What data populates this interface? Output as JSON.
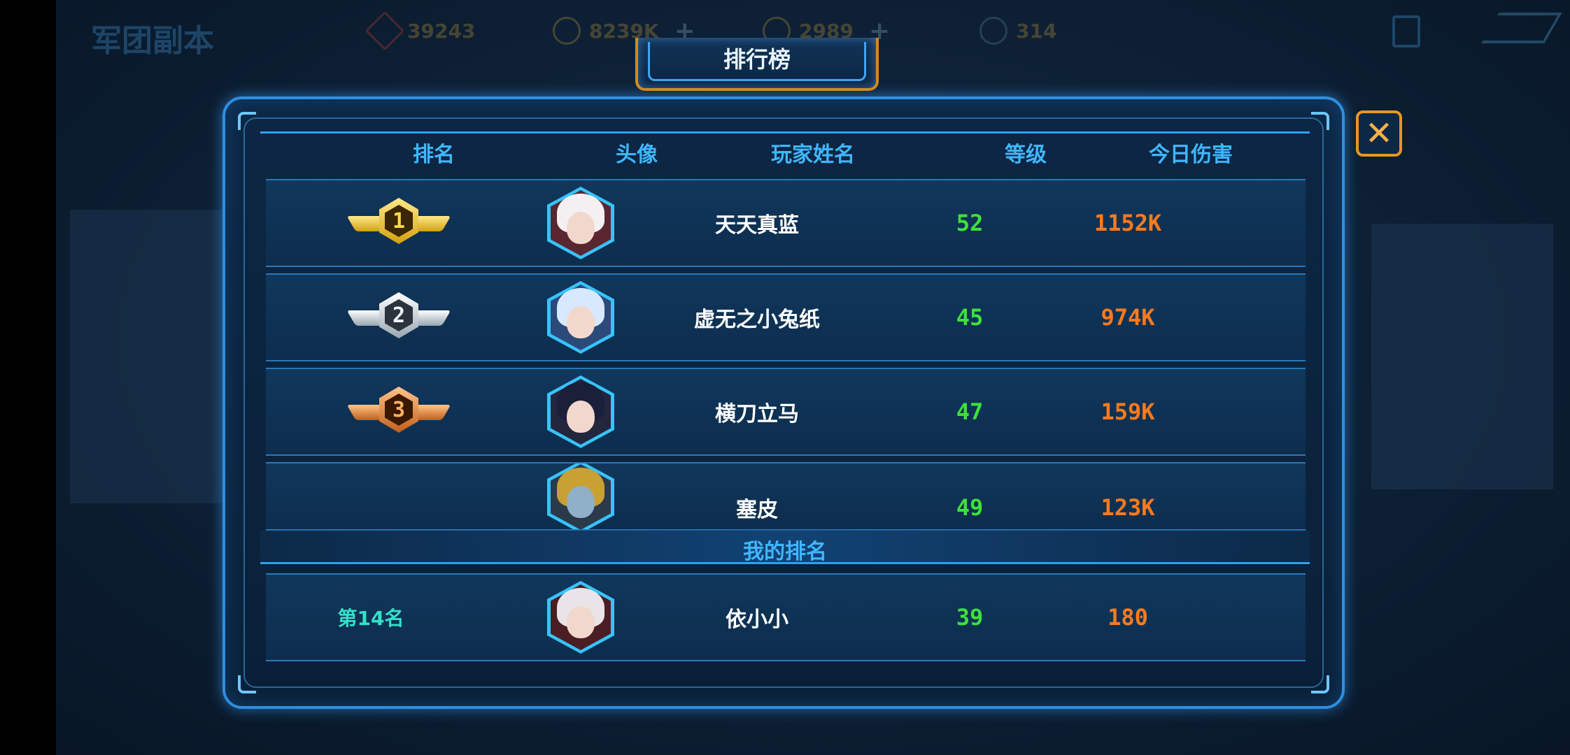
{
  "top_bar": {
    "title": "军团副本",
    "resources": [
      {
        "icon": "gem-icon",
        "value": "39243"
      },
      {
        "icon": "gold-coin-icon",
        "value": "8239K"
      },
      {
        "icon": "crown-icon",
        "value": "2989"
      },
      {
        "icon": "medal-icon",
        "value": "314"
      }
    ]
  },
  "leaderboard": {
    "title": "排行榜",
    "headers": {
      "rank": "排名",
      "avatar": "头像",
      "player_name": "玩家姓名",
      "level": "等级",
      "damage_today": "今日伤害"
    },
    "rows": [
      {
        "rank": "1",
        "name": "天天真蓝",
        "level": "52",
        "damage": "1152K",
        "hair_color": "#f4f0f2",
        "accent": "#c81d2a"
      },
      {
        "rank": "2",
        "name": "虚无之小兔纸",
        "level": "45",
        "damage": "974K",
        "hair_color": "#d8e8ff",
        "accent": "#3366cc"
      },
      {
        "rank": "3",
        "name": "横刀立马",
        "level": "47",
        "damage": "159K",
        "hair_color": "#1a1f3a",
        "accent": "#3a3f5a"
      },
      {
        "rank": "",
        "name": "塞皮",
        "level": "49",
        "damage": "123K",
        "hair_color": "#4a5c6a",
        "accent": "#c9a032"
      }
    ],
    "my_rank_label": "我的排名",
    "my_row": {
      "rank_text": "第14名",
      "name": "依小小",
      "level": "39",
      "damage": "180",
      "hair_color": "#eae4e8",
      "accent": "#b81c24"
    }
  },
  "colors": {
    "level": "#3ee03a",
    "damage": "#ff7a1e",
    "header": "#3fb6ff",
    "frame": "#2e8fe0",
    "close": "#e8961f"
  }
}
